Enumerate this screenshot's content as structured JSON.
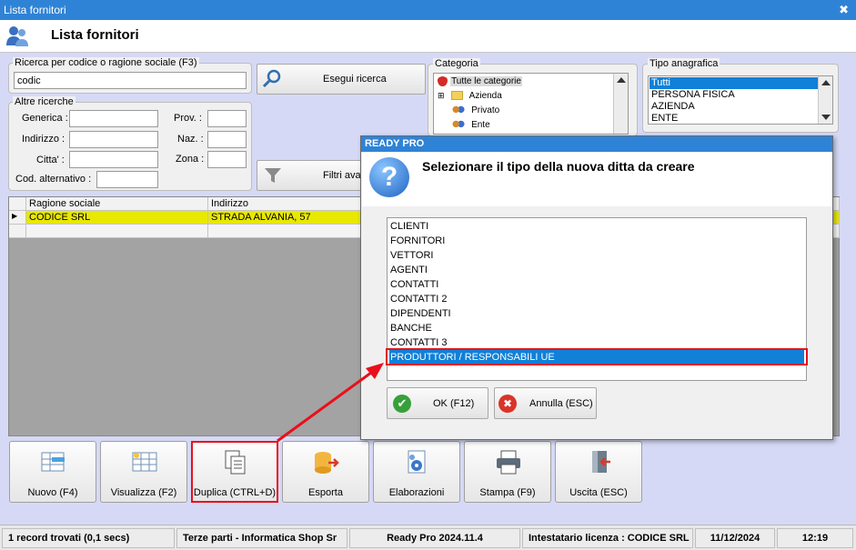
{
  "window": {
    "title": "Lista fornitori",
    "close_glyph": "✖"
  },
  "header": {
    "page_title": "Lista fornitori",
    "icon": "users-icon"
  },
  "search": {
    "group_label": "Ricerca per codice o ragione sociale (F3)",
    "value": "codic",
    "button_label": "Esegui ricerca",
    "filter_button_label": "Filtri ava"
  },
  "other_search": {
    "group_label": "Altre ricerche",
    "generica_label": "Generica :",
    "indirizzo_label": "Indirizzo :",
    "citta_label": "Citta' :",
    "cod_alt_label": "Cod. alternativo :",
    "prov_label": "Prov. :",
    "naz_label": "Naz. :",
    "zona_label": "Zona :"
  },
  "categoria": {
    "group_label": "Categoria",
    "items": [
      "Tutte le categorie",
      "Azienda",
      "Privato",
      "Ente"
    ]
  },
  "tipo_anagrafica": {
    "group_label": "Tipo anagrafica",
    "items": [
      "Tutti",
      "PERSONA FISICA",
      "AZIENDA",
      "ENTE"
    ],
    "selected": "Tutti"
  },
  "grid": {
    "columns": [
      "Ragione sociale",
      "Indirizzo"
    ],
    "rows": [
      {
        "ragione_sociale": "CODICE SRL",
        "indirizzo": "STRADA ALVANIA, 57"
      }
    ],
    "row_marker": "▶"
  },
  "toolbar": {
    "buttons": [
      {
        "label": "Nuovo (F4)"
      },
      {
        "label": "Visualizza (F2)"
      },
      {
        "label": "Duplica (CTRL+D)"
      },
      {
        "label": "Esporta"
      },
      {
        "label": "Elaborazioni"
      },
      {
        "label": "Stampa (F9)"
      },
      {
        "label": "Uscita (ESC)"
      }
    ]
  },
  "status_bar": {
    "records": "1 record trovati (0,1 secs)",
    "section": "Terze parti - Informatica Shop Sr",
    "version": "Ready Pro 2024.11.4",
    "license": "Intestatario licenza : CODICE SRL",
    "date": "11/12/2024",
    "time": "12:19"
  },
  "modal": {
    "title": "READY PRO",
    "message": "Selezionare il tipo della nuova ditta da creare",
    "question_glyph": "?",
    "options": [
      "CLIENTI",
      "FORNITORI",
      "VETTORI",
      "AGENTI",
      "CONTATTI",
      "CONTATTI 2",
      "DIPENDENTI",
      "BANCHE",
      "CONTATTI 3",
      "PRODUTTORI / RESPONSABILI UE"
    ],
    "selected": "PRODUTTORI / RESPONSABILI UE",
    "ok_label": "OK (F12)",
    "cancel_label": "Annulla (ESC)"
  },
  "colors": {
    "title_bar": "#2f83d6",
    "selected_row": "#e8e800",
    "selection_blue": "#1080d8",
    "annotation_red": "#e8101a"
  }
}
